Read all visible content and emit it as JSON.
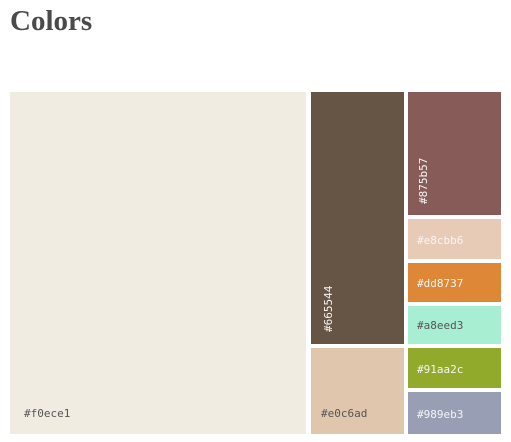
{
  "page": {
    "title": "Colors"
  },
  "swatches": [
    {
      "id": "f0ece1",
      "label": "#f0ece1",
      "color": "#f0ece1",
      "text_color": "#555555"
    },
    {
      "id": "665544",
      "label": "#665544",
      "color": "#665544",
      "text_color": "#f5f5f5"
    },
    {
      "id": "e0c6ad",
      "label": "#e0c6ad",
      "color": "#e0c6ad",
      "text_color": "#555555"
    },
    {
      "id": "875b57",
      "label": "#875b57",
      "color": "#875b57",
      "text_color": "#f5f5f5"
    },
    {
      "id": "e8cbb6",
      "label": "#e8cbb6",
      "color": "#e8cbb6",
      "text_color": "#f5f5f5"
    },
    {
      "id": "dd8737",
      "label": "#dd8737",
      "color": "#dd8737",
      "text_color": "#f5f5f5"
    },
    {
      "id": "a8eed3",
      "label": "#a8eed3",
      "color": "#a8eed3",
      "text_color": "#555555"
    },
    {
      "id": "91aa2c",
      "label": "#91aa2c",
      "color": "#91aa2c",
      "text_color": "#f5f5f5"
    },
    {
      "id": "989eb3",
      "label": "#989eb3",
      "color": "#989eb3",
      "text_color": "#f5f5f5"
    }
  ]
}
